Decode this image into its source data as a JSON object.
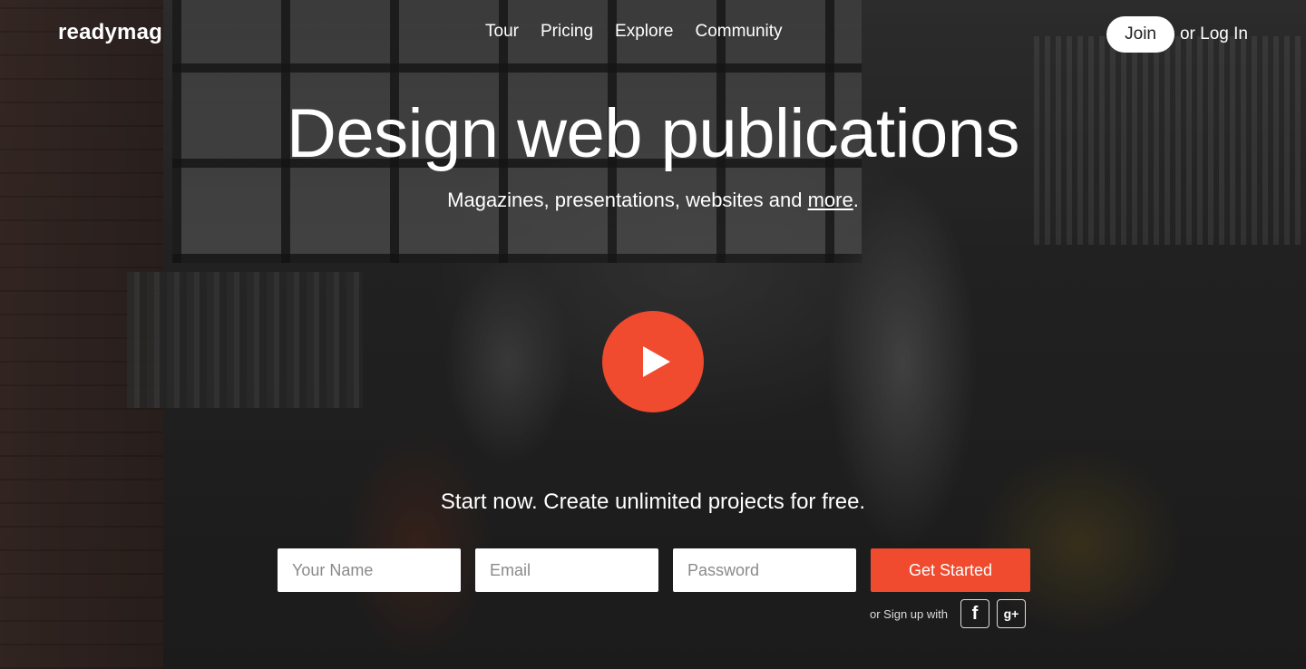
{
  "header": {
    "logo": "readymag",
    "nav": [
      "Tour",
      "Pricing",
      "Explore",
      "Community"
    ],
    "join_label": "Join",
    "login_prefix": "or ",
    "login_label": "Log In"
  },
  "hero": {
    "title": "Design web publications",
    "subtitle_prefix": "Magazines, presentations, websites and ",
    "subtitle_link": "more",
    "subtitle_suffix": ".",
    "play_icon": "play-icon"
  },
  "signup": {
    "cta": "Start now. Create unlimited projects for free.",
    "name_placeholder": "Your Name",
    "email_placeholder": "Email",
    "password_placeholder": "Password",
    "submit_label": "Get Started",
    "social_text": "or Sign up with",
    "facebook_glyph": "f",
    "google_glyph": "g+"
  },
  "colors": {
    "accent": "#f04a2f",
    "text": "#ffffff"
  }
}
